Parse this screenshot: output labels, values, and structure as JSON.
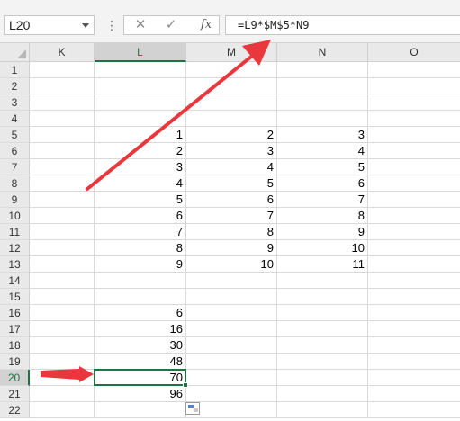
{
  "formula_bar": {
    "name_box": "L20",
    "formula": "=L9*$M$5*N9",
    "cancel_icon": "✕",
    "enter_icon": "✓",
    "fx_icon": "fx",
    "more_icon": "⋮"
  },
  "sheet": {
    "columns": [
      "K",
      "L",
      "M",
      "N",
      "O"
    ],
    "selected_column": "L",
    "rows": [
      "1",
      "2",
      "3",
      "4",
      "5",
      "6",
      "7",
      "8",
      "9",
      "10",
      "11",
      "12",
      "13",
      "14",
      "15",
      "16",
      "17",
      "18",
      "19",
      "20",
      "21",
      "22"
    ],
    "selected_row": "20",
    "cells": {
      "L5": "1",
      "L6": "2",
      "L7": "3",
      "L8": "4",
      "L9": "5",
      "L10": "6",
      "L11": "7",
      "L12": "8",
      "L13": "9",
      "M5": "2",
      "M6": "3",
      "M7": "4",
      "M8": "5",
      "M9": "6",
      "M10": "7",
      "M11": "8",
      "M12": "9",
      "M13": "10",
      "N5": "3",
      "N6": "4",
      "N7": "5",
      "N8": "6",
      "N9": "7",
      "N10": "8",
      "N11": "9",
      "N12": "10",
      "N13": "11",
      "L16": "6",
      "L17": "16",
      "L18": "30",
      "L19": "48",
      "L20": "70",
      "L21": "96"
    }
  },
  "annotations": {
    "arrow_color": "#e8383d",
    "active_cell_color": "#217346"
  }
}
